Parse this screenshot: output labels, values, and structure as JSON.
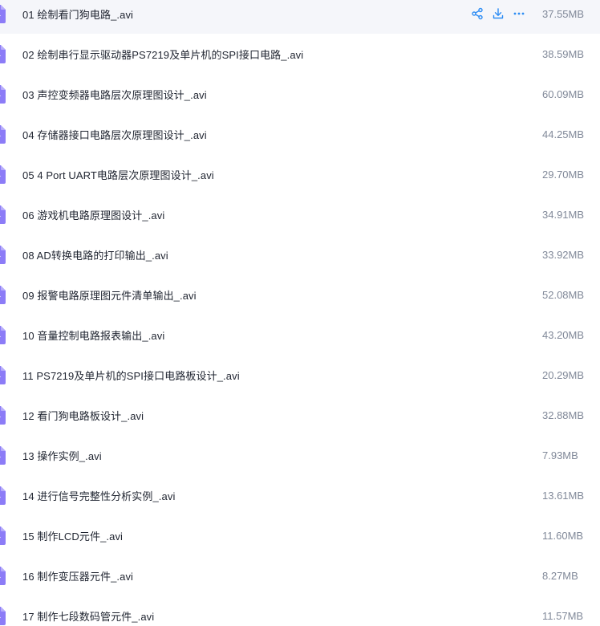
{
  "files": [
    {
      "name": "01 绘制看门狗电路_.avi",
      "size": "37.55MB",
      "hovered": true
    },
    {
      "name": "02 绘制串行显示驱动器PS7219及单片机的SPI接口电路_.avi",
      "size": "38.59MB"
    },
    {
      "name": "03 声控变频器电路层次原理图设计_.avi",
      "size": "60.09MB"
    },
    {
      "name": "04 存储器接口电路层次原理图设计_.avi",
      "size": "44.25MB"
    },
    {
      "name": "05 4 Port UART电路层次原理图设计_.avi",
      "size": "29.70MB"
    },
    {
      "name": "06 游戏机电路原理图设计_.avi",
      "size": "34.91MB"
    },
    {
      "name": "08 AD转换电路的打印输出_.avi",
      "size": "33.92MB"
    },
    {
      "name": "09 报警电路原理图元件清单输出_.avi",
      "size": "52.08MB"
    },
    {
      "name": "10 音量控制电路报表输出_.avi",
      "size": "43.20MB"
    },
    {
      "name": "11 PS7219及单片机的SPI接口电路板设计_.avi",
      "size": "20.29MB"
    },
    {
      "name": "12 看门狗电路板设计_.avi",
      "size": "32.88MB"
    },
    {
      "name": "13 操作实例_.avi",
      "size": "7.93MB"
    },
    {
      "name": "14 进行信号完整性分析实例_.avi",
      "size": "13.61MB"
    },
    {
      "name": "15 制作LCD元件_.avi",
      "size": "11.60MB"
    },
    {
      "name": "16 制作变压器元件_.avi",
      "size": "8.27MB"
    },
    {
      "name": "17 制作七段数码管元件_.avi",
      "size": "11.57MB"
    }
  ],
  "row_actions": {
    "share_icon": "share-icon",
    "download_icon": "download-icon",
    "more_icon": "more-icon"
  },
  "colors": {
    "video_icon": "#8c7cf7",
    "action_icon": "#2c8cf4",
    "hover_bg": "#f5f6fa",
    "name_text": "#1f2430",
    "size_text": "#818999"
  }
}
